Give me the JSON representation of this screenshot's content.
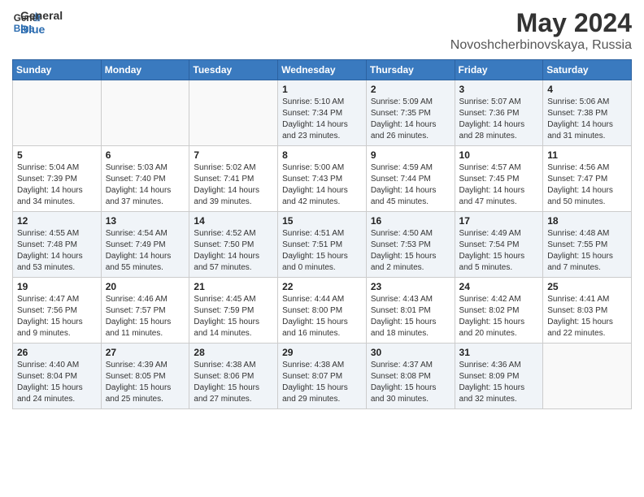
{
  "header": {
    "logo_line1": "General",
    "logo_line2": "Blue",
    "title": "May 2024",
    "subtitle": "Novoshcherbinovskaya, Russia"
  },
  "days_of_week": [
    "Sunday",
    "Monday",
    "Tuesday",
    "Wednesday",
    "Thursday",
    "Friday",
    "Saturday"
  ],
  "weeks": [
    [
      {
        "day": "",
        "info": ""
      },
      {
        "day": "",
        "info": ""
      },
      {
        "day": "",
        "info": ""
      },
      {
        "day": "1",
        "info": "Sunrise: 5:10 AM\nSunset: 7:34 PM\nDaylight: 14 hours\nand 23 minutes."
      },
      {
        "day": "2",
        "info": "Sunrise: 5:09 AM\nSunset: 7:35 PM\nDaylight: 14 hours\nand 26 minutes."
      },
      {
        "day": "3",
        "info": "Sunrise: 5:07 AM\nSunset: 7:36 PM\nDaylight: 14 hours\nand 28 minutes."
      },
      {
        "day": "4",
        "info": "Sunrise: 5:06 AM\nSunset: 7:38 PM\nDaylight: 14 hours\nand 31 minutes."
      }
    ],
    [
      {
        "day": "5",
        "info": "Sunrise: 5:04 AM\nSunset: 7:39 PM\nDaylight: 14 hours\nand 34 minutes."
      },
      {
        "day": "6",
        "info": "Sunrise: 5:03 AM\nSunset: 7:40 PM\nDaylight: 14 hours\nand 37 minutes."
      },
      {
        "day": "7",
        "info": "Sunrise: 5:02 AM\nSunset: 7:41 PM\nDaylight: 14 hours\nand 39 minutes."
      },
      {
        "day": "8",
        "info": "Sunrise: 5:00 AM\nSunset: 7:43 PM\nDaylight: 14 hours\nand 42 minutes."
      },
      {
        "day": "9",
        "info": "Sunrise: 4:59 AM\nSunset: 7:44 PM\nDaylight: 14 hours\nand 45 minutes."
      },
      {
        "day": "10",
        "info": "Sunrise: 4:57 AM\nSunset: 7:45 PM\nDaylight: 14 hours\nand 47 minutes."
      },
      {
        "day": "11",
        "info": "Sunrise: 4:56 AM\nSunset: 7:47 PM\nDaylight: 14 hours\nand 50 minutes."
      }
    ],
    [
      {
        "day": "12",
        "info": "Sunrise: 4:55 AM\nSunset: 7:48 PM\nDaylight: 14 hours\nand 53 minutes."
      },
      {
        "day": "13",
        "info": "Sunrise: 4:54 AM\nSunset: 7:49 PM\nDaylight: 14 hours\nand 55 minutes."
      },
      {
        "day": "14",
        "info": "Sunrise: 4:52 AM\nSunset: 7:50 PM\nDaylight: 14 hours\nand 57 minutes."
      },
      {
        "day": "15",
        "info": "Sunrise: 4:51 AM\nSunset: 7:51 PM\nDaylight: 15 hours\nand 0 minutes."
      },
      {
        "day": "16",
        "info": "Sunrise: 4:50 AM\nSunset: 7:53 PM\nDaylight: 15 hours\nand 2 minutes."
      },
      {
        "day": "17",
        "info": "Sunrise: 4:49 AM\nSunset: 7:54 PM\nDaylight: 15 hours\nand 5 minutes."
      },
      {
        "day": "18",
        "info": "Sunrise: 4:48 AM\nSunset: 7:55 PM\nDaylight: 15 hours\nand 7 minutes."
      }
    ],
    [
      {
        "day": "19",
        "info": "Sunrise: 4:47 AM\nSunset: 7:56 PM\nDaylight: 15 hours\nand 9 minutes."
      },
      {
        "day": "20",
        "info": "Sunrise: 4:46 AM\nSunset: 7:57 PM\nDaylight: 15 hours\nand 11 minutes."
      },
      {
        "day": "21",
        "info": "Sunrise: 4:45 AM\nSunset: 7:59 PM\nDaylight: 15 hours\nand 14 minutes."
      },
      {
        "day": "22",
        "info": "Sunrise: 4:44 AM\nSunset: 8:00 PM\nDaylight: 15 hours\nand 16 minutes."
      },
      {
        "day": "23",
        "info": "Sunrise: 4:43 AM\nSunset: 8:01 PM\nDaylight: 15 hours\nand 18 minutes."
      },
      {
        "day": "24",
        "info": "Sunrise: 4:42 AM\nSunset: 8:02 PM\nDaylight: 15 hours\nand 20 minutes."
      },
      {
        "day": "25",
        "info": "Sunrise: 4:41 AM\nSunset: 8:03 PM\nDaylight: 15 hours\nand 22 minutes."
      }
    ],
    [
      {
        "day": "26",
        "info": "Sunrise: 4:40 AM\nSunset: 8:04 PM\nDaylight: 15 hours\nand 24 minutes."
      },
      {
        "day": "27",
        "info": "Sunrise: 4:39 AM\nSunset: 8:05 PM\nDaylight: 15 hours\nand 25 minutes."
      },
      {
        "day": "28",
        "info": "Sunrise: 4:38 AM\nSunset: 8:06 PM\nDaylight: 15 hours\nand 27 minutes."
      },
      {
        "day": "29",
        "info": "Sunrise: 4:38 AM\nSunset: 8:07 PM\nDaylight: 15 hours\nand 29 minutes."
      },
      {
        "day": "30",
        "info": "Sunrise: 4:37 AM\nSunset: 8:08 PM\nDaylight: 15 hours\nand 30 minutes."
      },
      {
        "day": "31",
        "info": "Sunrise: 4:36 AM\nSunset: 8:09 PM\nDaylight: 15 hours\nand 32 minutes."
      },
      {
        "day": "",
        "info": ""
      }
    ]
  ]
}
